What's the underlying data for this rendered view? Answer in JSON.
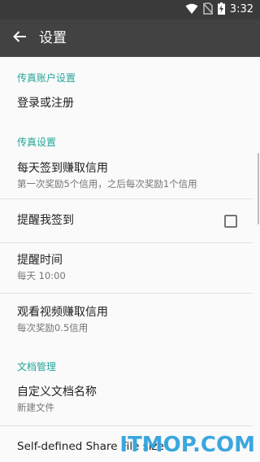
{
  "status_bar": {
    "time": "3:32",
    "icons": [
      "wifi-icon",
      "no-sim-icon",
      "battery-charging-icon"
    ]
  },
  "app_bar": {
    "back_icon": "arrow-left-icon",
    "title": "设置"
  },
  "sections": {
    "account": {
      "header": "传真账户设置",
      "login_title": "登录或注册"
    },
    "fax": {
      "header": "传真设置",
      "daily_signin_title": "每天签到赚取信用",
      "daily_signin_summary": "第一次奖励5个信用，之后每次奖励1个信用",
      "remind_signin_title": "提醒我签到",
      "remind_signin_checked": false,
      "remind_time_title": "提醒时间",
      "remind_time_summary": "每天 10:00",
      "video_credit_title": "观看视频赚取信用",
      "video_credit_summary": "每次奖励0.5信用"
    },
    "docs": {
      "header": "文档管理",
      "custom_name_title": "自定义文档名称",
      "custom_name_summary": "新建文件",
      "share_file_size_title": "Self-defined Share File size"
    }
  },
  "watermark": {
    "text": "ITMOP.COM"
  },
  "colors": {
    "status_bar": "#3a3a3a",
    "app_bar": "#424242",
    "accent": "#26a69a",
    "background": "#fafafa",
    "watermark": "#3aa7de"
  }
}
